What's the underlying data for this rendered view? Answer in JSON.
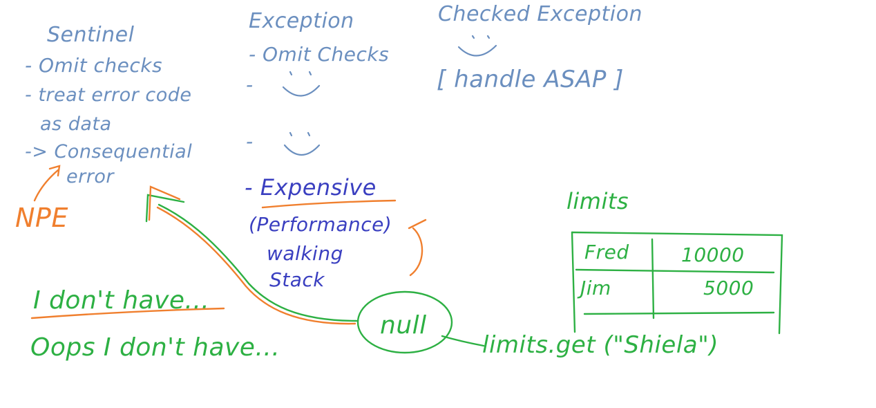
{
  "colors": {
    "light_blue": "#6b8fbf",
    "dark_blue": "#3a3fc0",
    "green": "#2db043",
    "orange": "#f07f2e"
  },
  "sentinel": {
    "title": "Sentinel",
    "item1": "- Omit checks",
    "item2a": "- treat error code",
    "item2b": "as data",
    "item3a": "-> Consequential",
    "item3b": "error"
  },
  "npe": "NPE",
  "exception": {
    "title": "Exception",
    "item1": "- Omit Checks",
    "dash2": "-",
    "dash3": "-",
    "expensive": "- Expensive",
    "performance": "(Performance)",
    "walking": "walking",
    "stack": "Stack"
  },
  "checked": {
    "title": "Checked Exception",
    "handle": "[ handle ASAP ]"
  },
  "dont_have": "I don't have...",
  "oops": "Oops I don't have...",
  "null_label": "null",
  "limits_get": "limits.get (\"Shiela\")",
  "limits_table": {
    "title": "limits",
    "rows": [
      {
        "name": "Fred",
        "value": "10000"
      },
      {
        "name": "Jim",
        "value": "5000"
      }
    ]
  }
}
